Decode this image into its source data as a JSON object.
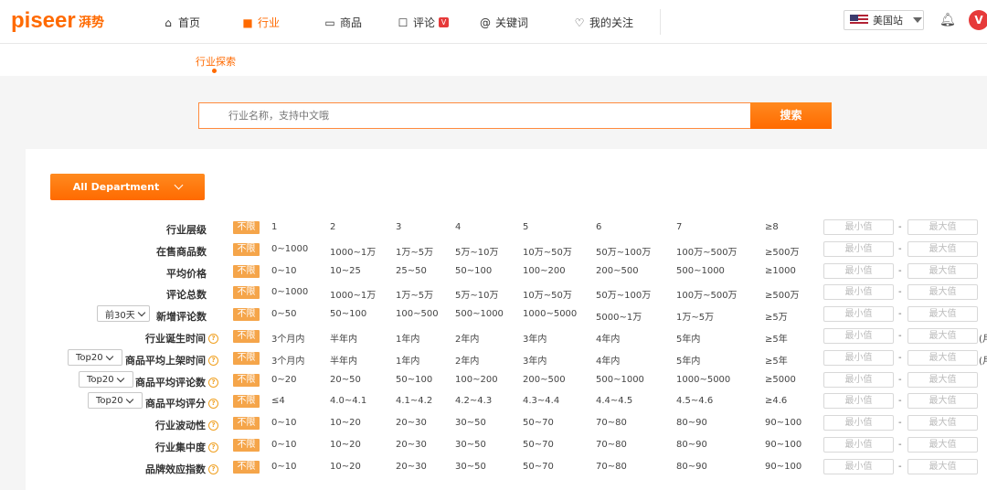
{
  "brand": {
    "logo": "piseer",
    "name_cn": "湃势"
  },
  "nav": [
    {
      "icon": "home-icon",
      "glyph": "⌂",
      "label": "首页"
    },
    {
      "icon": "industry-icon",
      "glyph": "■",
      "label": "行业"
    },
    {
      "icon": "product-icon",
      "glyph": "▭",
      "label": "商品"
    },
    {
      "icon": "review-icon",
      "glyph": "☐",
      "label": "评论"
    },
    {
      "icon": "keyword-icon",
      "glyph": "@",
      "label": "关键词"
    },
    {
      "icon": "heart-icon",
      "glyph": "♡",
      "label": "我的关注"
    }
  ],
  "nav_review_badge": "V",
  "site_select": {
    "label": "美国站"
  },
  "avatar": "V",
  "subnav": {
    "label": "行业探索"
  },
  "search": {
    "placeholder": "行业名称，支持中文哦",
    "button": "搜索"
  },
  "department": {
    "label": "All Department"
  },
  "filters": {
    "unlimited_label": "不限",
    "min_placeholder": "最小值",
    "max_placeholder": "最大值",
    "dash": "-",
    "rows": [
      {
        "label": "行业层级",
        "prefix": "",
        "help": false,
        "suffix": "",
        "options": [
          "1",
          "2",
          "3",
          "4",
          "5",
          "6",
          "7",
          "≥8"
        ]
      },
      {
        "label": "在售商品数",
        "prefix": "",
        "help": false,
        "suffix": "",
        "options": [
          "0~1000",
          "1000~1万",
          "1万~5万",
          "5万~10万",
          "10万~50万",
          "50万~100万",
          "100万~500万",
          "≥500万"
        ]
      },
      {
        "label": "平均价格",
        "prefix": "",
        "help": false,
        "suffix": "",
        "options": [
          "0~10",
          "10~25",
          "25~50",
          "50~100",
          "100~200",
          "200~500",
          "500~1000",
          "≥1000"
        ]
      },
      {
        "label": "评论总数",
        "prefix": "",
        "help": false,
        "suffix": "",
        "options": [
          "0~1000",
          "1000~1万",
          "1万~5万",
          "5万~10万",
          "10万~50万",
          "50万~100万",
          "100万~500万",
          "≥500万"
        ]
      },
      {
        "label": "新增评论数",
        "prefix": "前30天",
        "help": false,
        "suffix": "",
        "options": [
          "0~50",
          "50~100",
          "100~500",
          "500~1000",
          "1000~5000",
          "5000~1万",
          "1万~5万",
          "≥5万"
        ]
      },
      {
        "label": "行业诞生时间",
        "prefix": "",
        "help": true,
        "suffix": "(月",
        "options": [
          "3个月内",
          "半年内",
          "1年内",
          "2年内",
          "3年内",
          "4年内",
          "5年内",
          "≥5年"
        ]
      },
      {
        "label": "商品平均上架时间",
        "prefix": "Top20",
        "help": true,
        "suffix": "(月",
        "options": [
          "3个月内",
          "半年内",
          "1年内",
          "2年内",
          "3年内",
          "4年内",
          "5年内",
          "≥5年"
        ]
      },
      {
        "label": "商品平均评论数",
        "prefix": "Top20",
        "help": true,
        "suffix": "",
        "options": [
          "0~20",
          "20~50",
          "50~100",
          "100~200",
          "200~500",
          "500~1000",
          "1000~5000",
          "≥5000"
        ]
      },
      {
        "label": "商品平均评分",
        "prefix": "Top20",
        "help": true,
        "suffix": "",
        "options": [
          "≤4",
          "4.0~4.1",
          "4.1~4.2",
          "4.2~4.3",
          "4.3~4.4",
          "4.4~4.5",
          "4.5~4.6",
          "≥4.6"
        ]
      },
      {
        "label": "行业波动性",
        "prefix": "",
        "help": true,
        "suffix": "",
        "options": [
          "0~10",
          "10~20",
          "20~30",
          "30~50",
          "50~70",
          "70~80",
          "80~90",
          "90~100"
        ]
      },
      {
        "label": "行业集中度",
        "prefix": "",
        "help": true,
        "suffix": "",
        "options": [
          "0~10",
          "10~20",
          "20~30",
          "30~50",
          "50~70",
          "70~80",
          "80~90",
          "90~100"
        ]
      },
      {
        "label": "品牌效应指数",
        "prefix": "",
        "help": true,
        "suffix": "",
        "options": [
          "0~10",
          "10~20",
          "20~30",
          "30~50",
          "50~70",
          "70~80",
          "80~90",
          "90~100"
        ]
      }
    ]
  }
}
